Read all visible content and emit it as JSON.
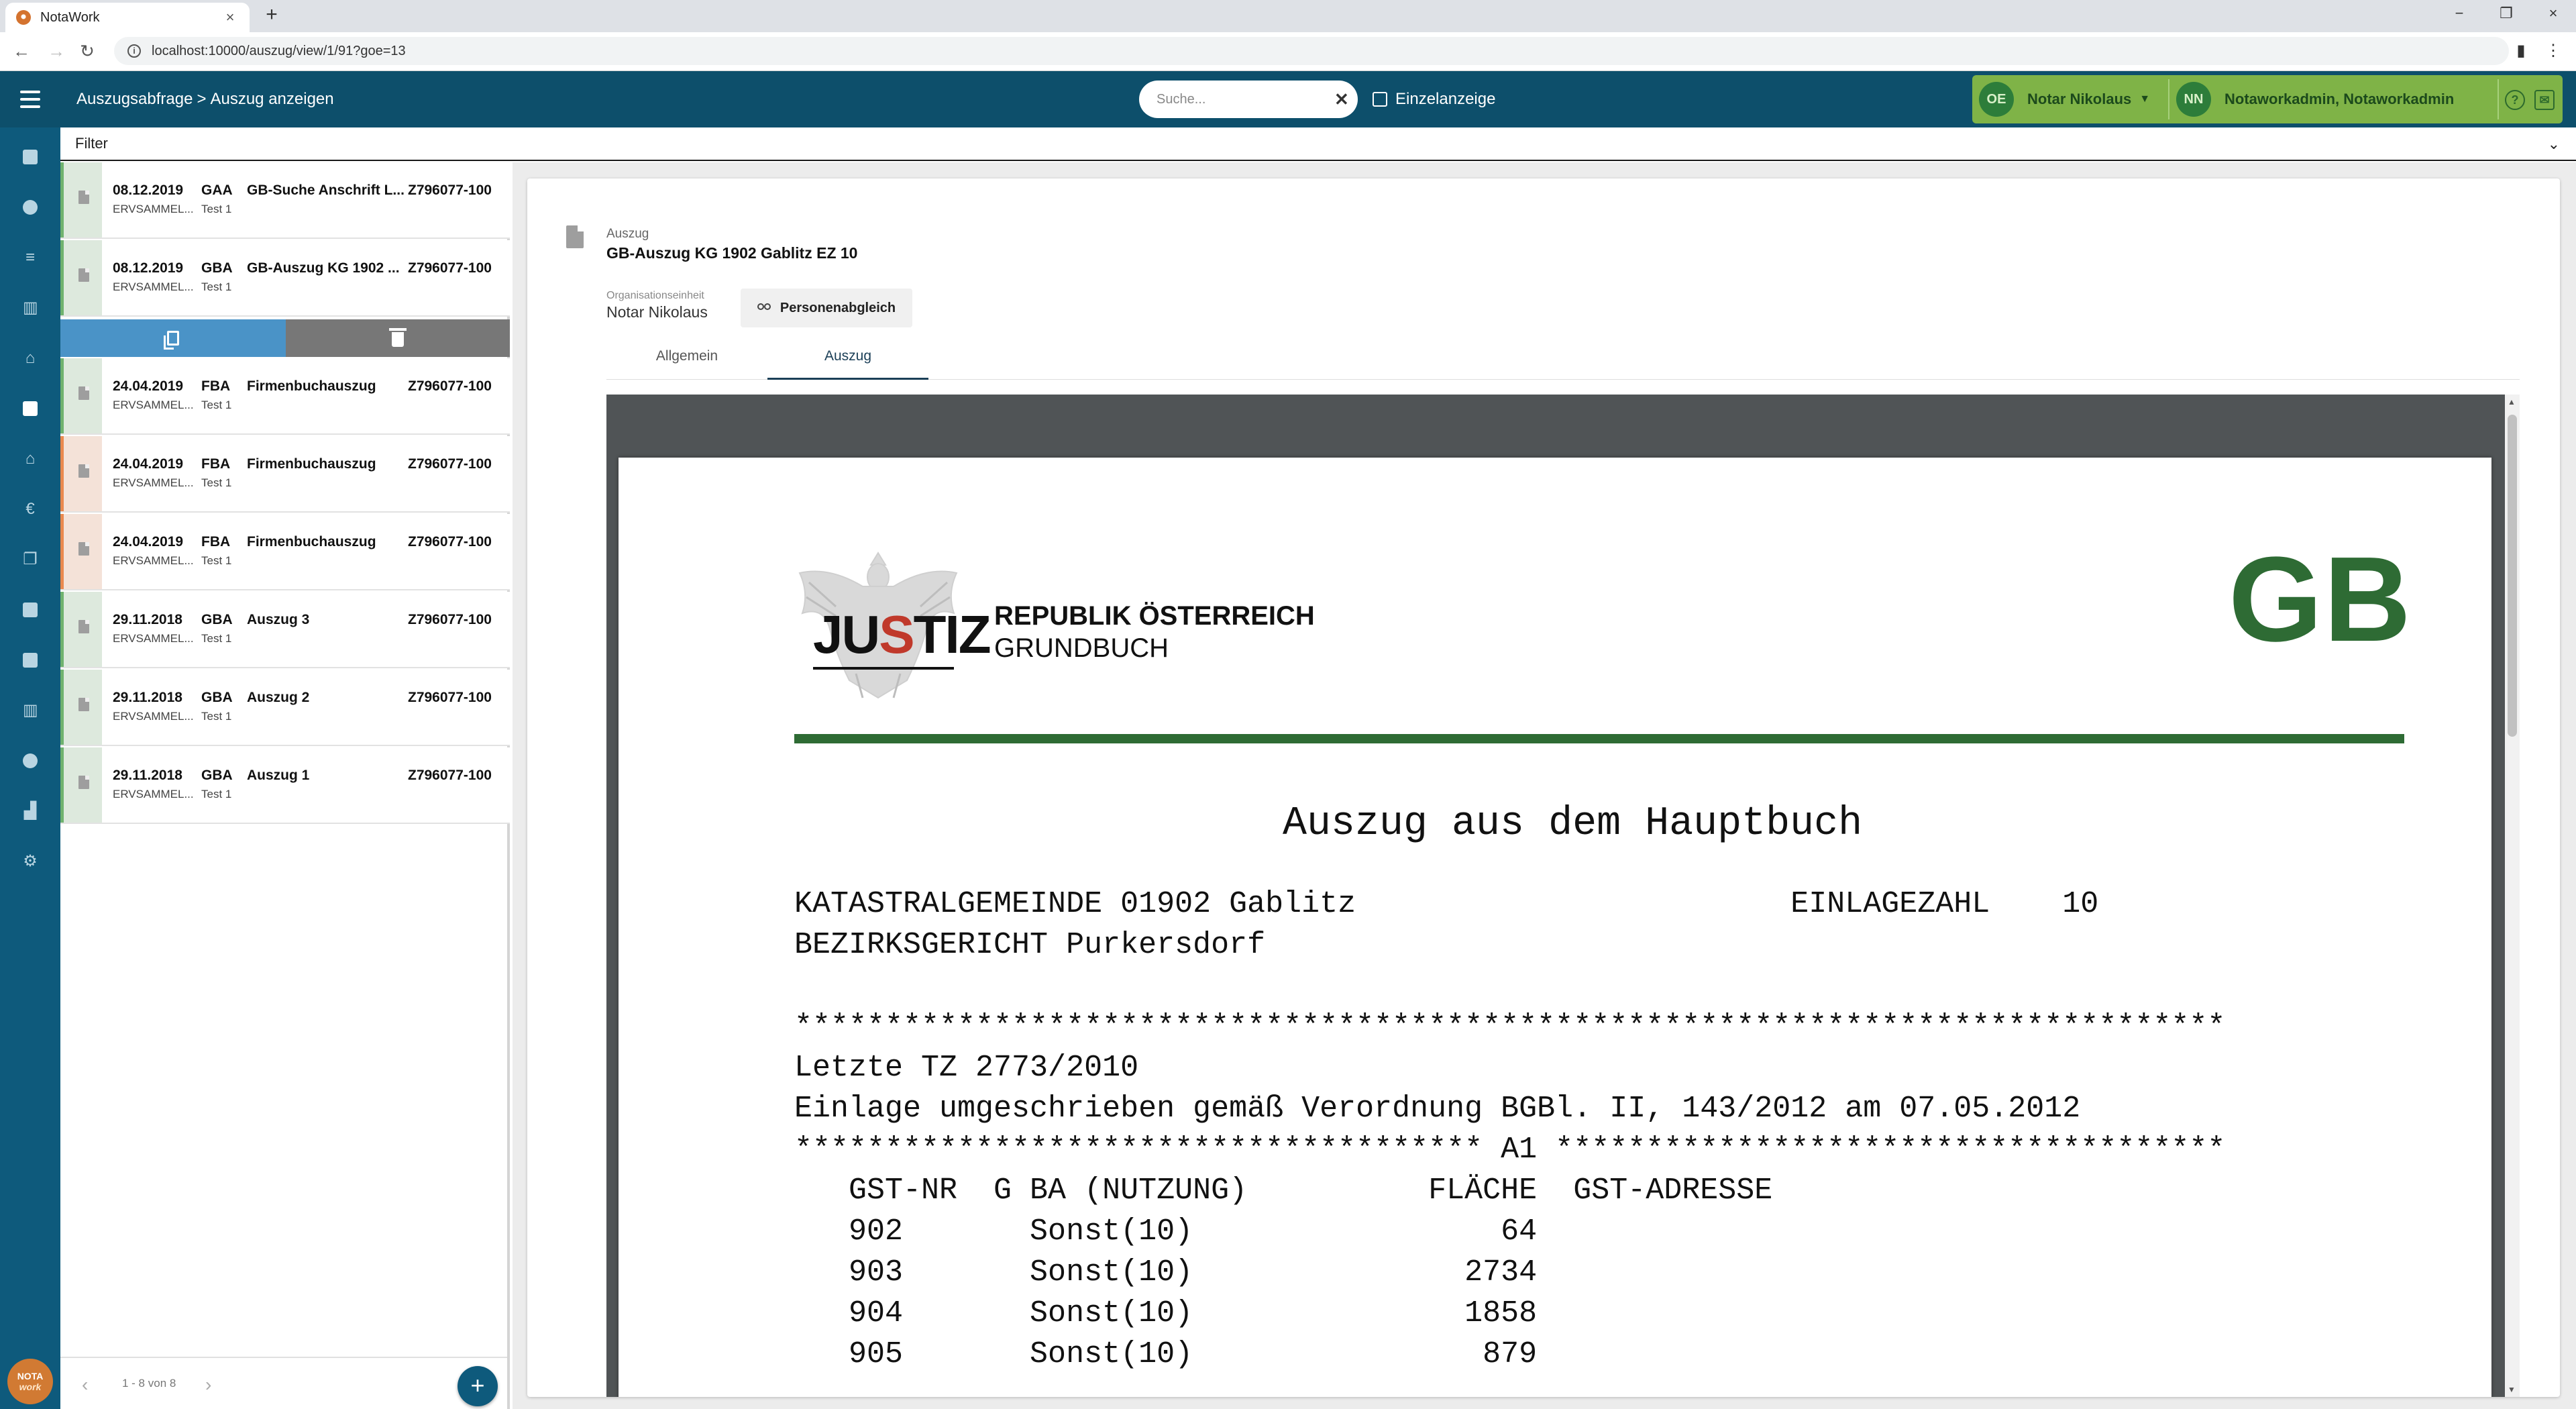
{
  "browser": {
    "tab_title": "NotaWork",
    "url": "localhost:10000/auszug/view/1/91?goe=13"
  },
  "header": {
    "breadcrumb": [
      "Auszugsabfrage",
      "Auszug anzeigen"
    ],
    "breadcrumb_sep": ">",
    "search_placeholder": "Suche...",
    "single_view_label": "Einzelanzeige",
    "org_avatar": "OE",
    "org_name": "Notar Nikolaus",
    "user_avatar": "NN",
    "user_name": "Notaworkadmin, Notaworkadmin",
    "colors": {
      "appbar": "#0d4f6b",
      "user_area": "#7fb347",
      "sidebar": "#0e5a7c"
    }
  },
  "sidebar": {
    "icons": [
      "calendar-icon",
      "person-icon",
      "list-icon",
      "books-icon",
      "bank-icon",
      "document-icon",
      "institution-icon",
      "euro-icon",
      "copy-icon",
      "square-icon",
      "page-icon",
      "library-icon",
      "info-icon",
      "chart-icon",
      "gear-icon"
    ],
    "selected": "document-icon",
    "logo_top": "NOTA",
    "logo_bottom": "work"
  },
  "filter": {
    "label": "Filter"
  },
  "list": {
    "rows": [
      {
        "date": "08.12.2019",
        "code": "GAA",
        "desc": "GB-Suche Anschrift L...",
        "ref": "Z796077-100",
        "sub1": "ERVSAMMEL...",
        "sub2": "Test 1",
        "status": "green"
      },
      {
        "date": "08.12.2019",
        "code": "GBA",
        "desc": "GB-Auszug KG 1902 ...",
        "ref": "Z796077-100",
        "sub1": "ERVSAMMEL...",
        "sub2": "Test 1",
        "status": "green",
        "selected": true
      },
      {
        "date": "24.04.2019",
        "code": "FBA",
        "desc": "Firmenbuchauszug",
        "ref": "Z796077-100",
        "sub1": "ERVSAMMEL...",
        "sub2": "Test 1",
        "status": "green"
      },
      {
        "date": "24.04.2019",
        "code": "FBA",
        "desc": "Firmenbuchauszug",
        "ref": "Z796077-100",
        "sub1": "ERVSAMMEL...",
        "sub2": "Test 1",
        "status": "orange"
      },
      {
        "date": "24.04.2019",
        "code": "FBA",
        "desc": "Firmenbuchauszug",
        "ref": "Z796077-100",
        "sub1": "ERVSAMMEL...",
        "sub2": "Test 1",
        "status": "orange"
      },
      {
        "date": "29.11.2018",
        "code": "GBA",
        "desc": "Auszug 3",
        "ref": "Z796077-100",
        "sub1": "ERVSAMMEL...",
        "sub2": "Test 1",
        "status": "green"
      },
      {
        "date": "29.11.2018",
        "code": "GBA",
        "desc": "Auszug 2",
        "ref": "Z796077-100",
        "sub1": "ERVSAMMEL...",
        "sub2": "Test 1",
        "status": "green"
      },
      {
        "date": "29.11.2018",
        "code": "GBA",
        "desc": "Auszug 1",
        "ref": "Z796077-100",
        "sub1": "ERVSAMMEL...",
        "sub2": "Test 1",
        "status": "green"
      }
    ],
    "pagination": "1 - 8 von 8"
  },
  "detail": {
    "kicker": "Auszug",
    "title": "GB-Auszug KG 1902 Gablitz EZ 10",
    "org_label": "Organisationseinheit",
    "org_value": "Notar Nikolaus",
    "person_button": "Personenabgleich",
    "tabs": [
      "Allgemein",
      "Auszug"
    ],
    "active_tab": "Auszug"
  },
  "document": {
    "logo_text": "JUSTIZ",
    "republic": "REPUBLIK ÖSTERREICH",
    "registry": "GRUNDBUCH",
    "badge": "GB",
    "heading": "Auszug aus dem Hauptbuch",
    "lines": [
      "KATASTRALGEMEINDE 01902 Gablitz                        EINLAGEZAHL    10",
      "BEZIRKSGERICHT Purkersdorf",
      "",
      "*******************************************************************************",
      "Letzte TZ 2773/2010",
      "Einlage umgeschrieben gemäß Verordnung BGBl. II, 143/2012 am 07.05.2012",
      "************************************** A1 *************************************",
      "   GST-NR  G BA (NUTZUNG)          FLÄCHE  GST-ADRESSE",
      "   902       Sonst(10)                 64",
      "   903       Sonst(10)               2734",
      "   904       Sonst(10)               1858",
      "   905       Sonst(10)                879"
    ]
  }
}
